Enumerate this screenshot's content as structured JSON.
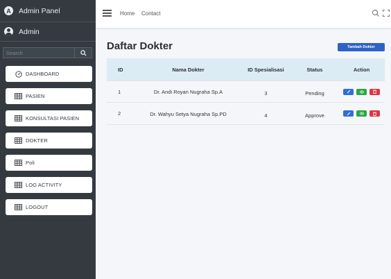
{
  "sidebar": {
    "brand": {
      "logo_letter": "A",
      "title": "Admin Panel"
    },
    "user": {
      "name": "Admin"
    },
    "search": {
      "placeholder": "Search"
    },
    "items": [
      {
        "label": "DASHBOARD",
        "icon": "dashboard-icon"
      },
      {
        "label": "PASIEN",
        "icon": "table-icon"
      },
      {
        "label": "KONSULTASI PASIEN",
        "icon": "table-icon"
      },
      {
        "label": "DOKTER",
        "icon": "table-icon"
      },
      {
        "label": "Poli",
        "icon": "table-icon"
      },
      {
        "label": "LOG ACTIVITY",
        "icon": "table-icon"
      },
      {
        "label": "LOGOUT",
        "icon": "table-icon"
      }
    ]
  },
  "navbar": {
    "links": [
      "Home",
      "Contact"
    ],
    "icons": [
      "menu-icon",
      "search-icon",
      "fullscreen-icon"
    ]
  },
  "main": {
    "title": "Daftar Dokter",
    "add_button": "Tambah Dokter",
    "table": {
      "headers": [
        "ID",
        "Nama Dokter",
        "ID Spesialisasi",
        "Status",
        "Action"
      ],
      "rows": [
        {
          "id": "1",
          "name": "Dr. Andi Royan Nugraha Sp.A",
          "spesialisasi": "3",
          "status": "Pending"
        },
        {
          "id": "2",
          "name": "Dr. Wahyu Setya Nugraha Sp.PD",
          "spesialisasi": "4",
          "status": "Approve"
        }
      ]
    }
  },
  "colors": {
    "sidebar_bg": "#343a40",
    "header_bg": "#dcecf4",
    "primary": "#2f62c7",
    "success": "#28a745",
    "danger": "#dc3545"
  }
}
